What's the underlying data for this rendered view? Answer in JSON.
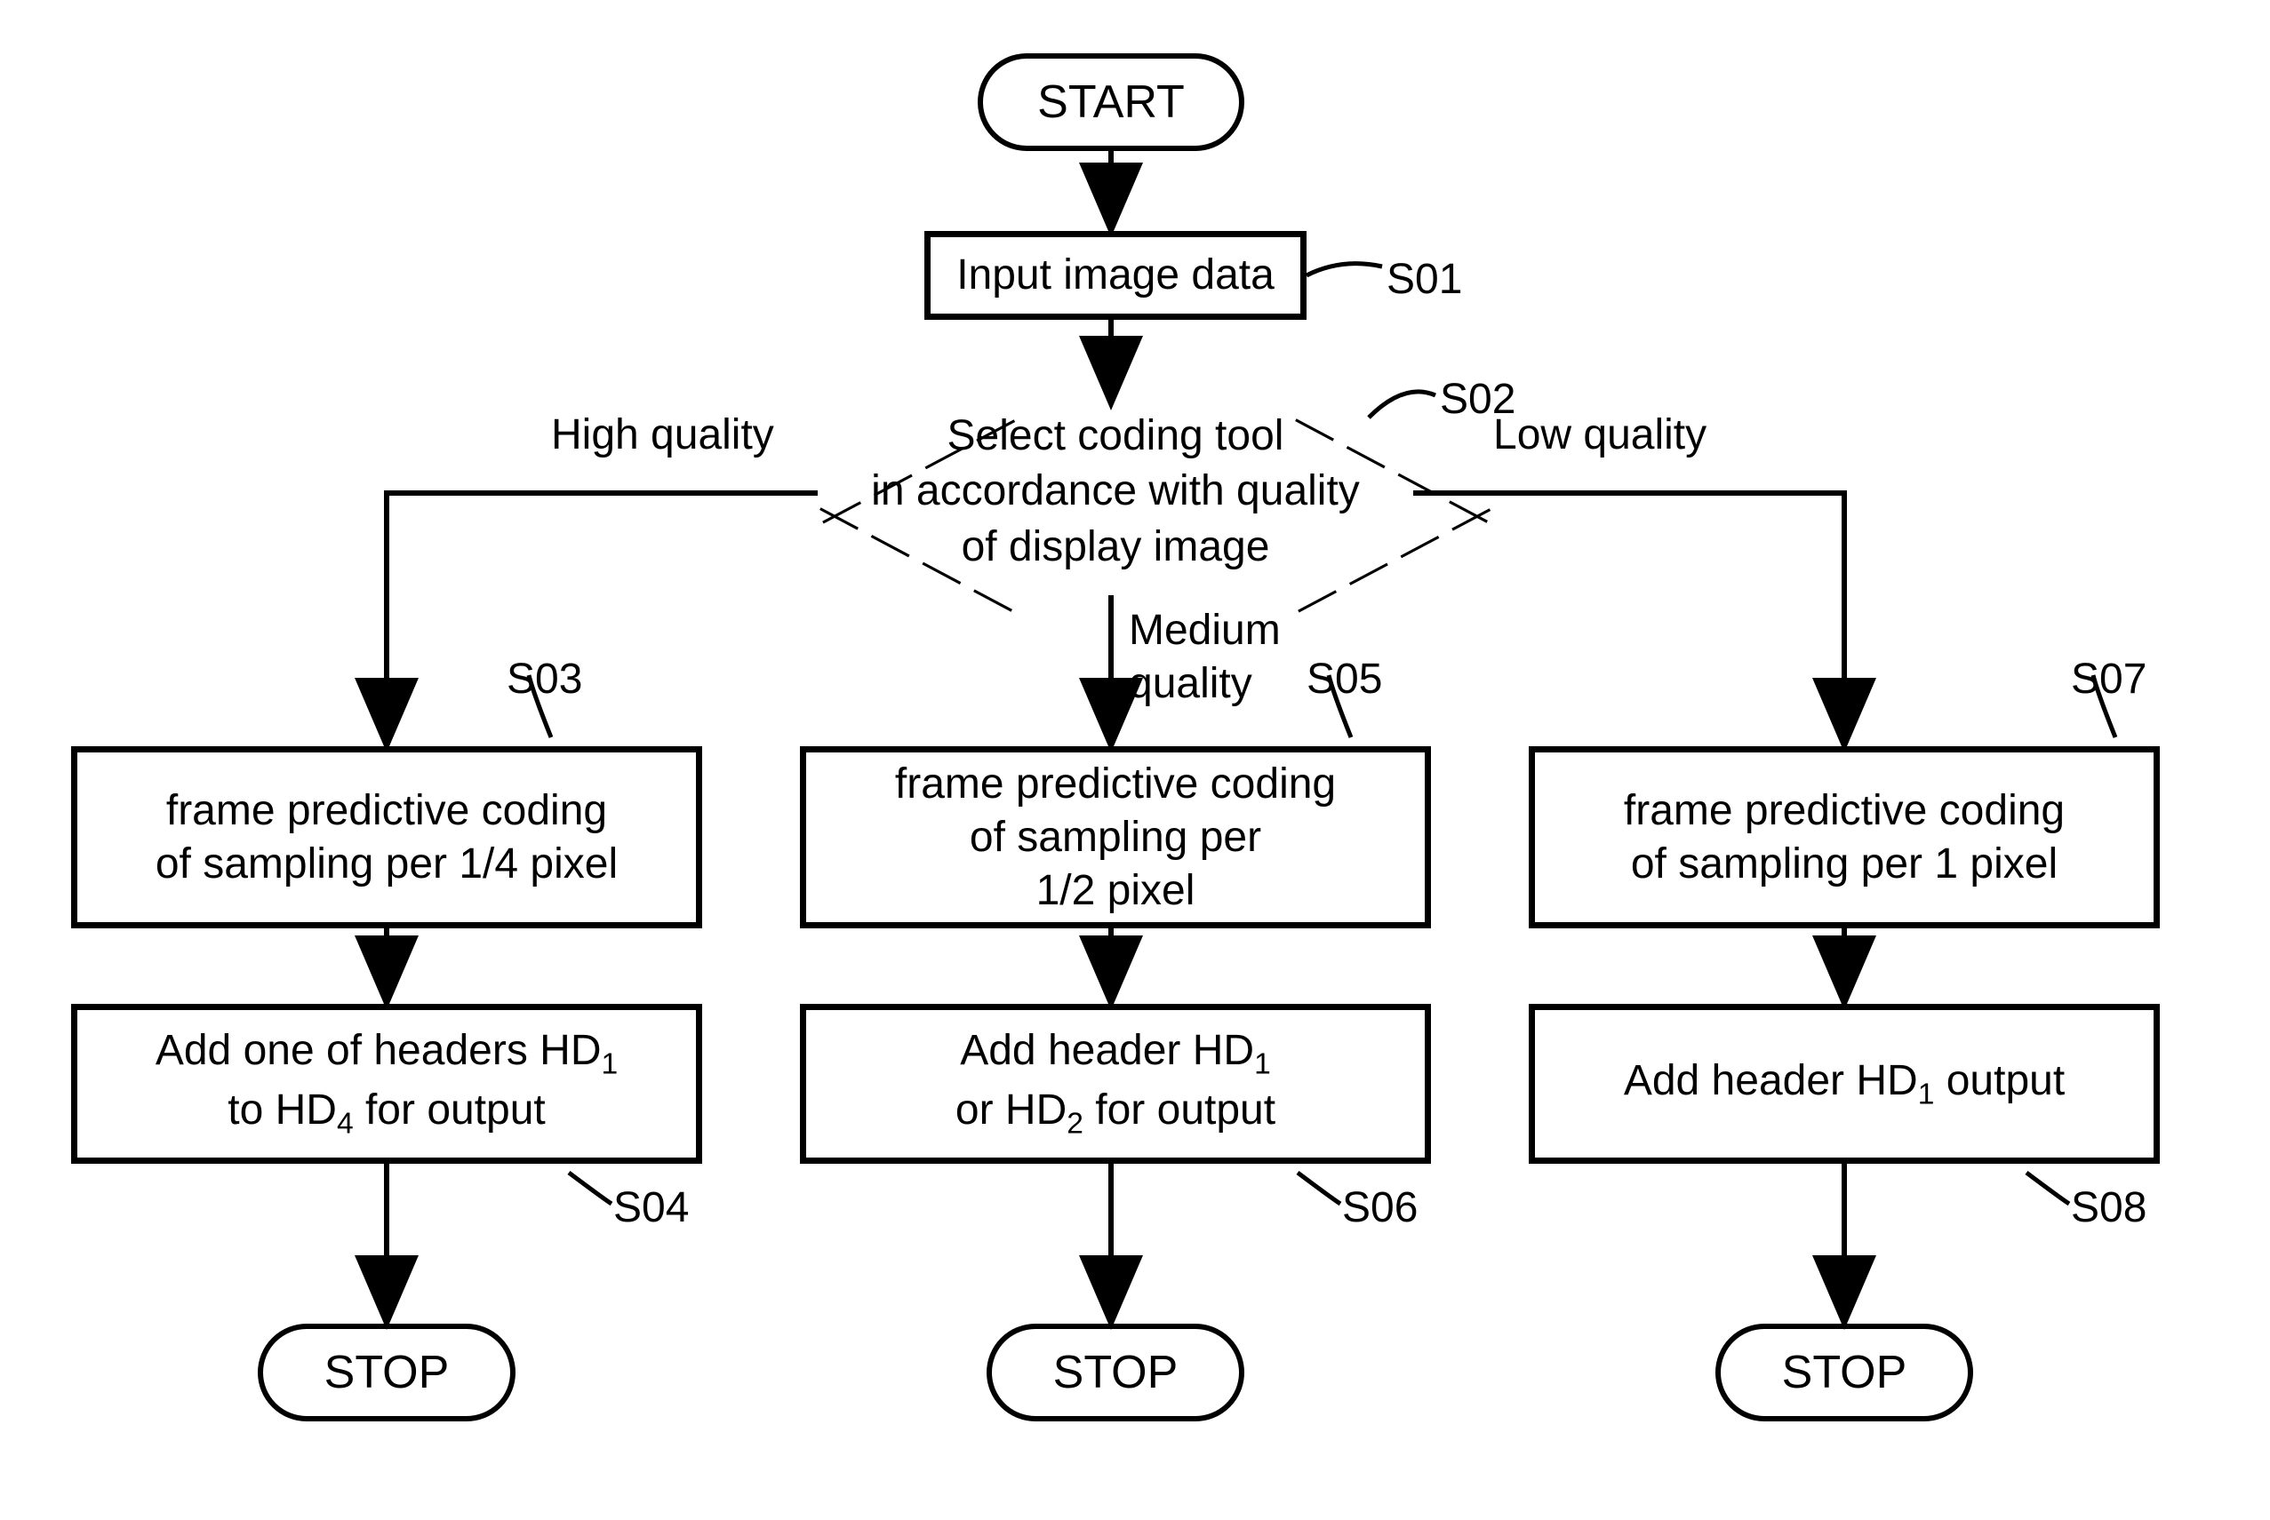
{
  "terminators": {
    "start": "START",
    "stop1": "STOP",
    "stop2": "STOP",
    "stop3": "STOP"
  },
  "steps": {
    "s01": {
      "label": "S01",
      "text": "Input image data"
    },
    "s02": {
      "label": "S02",
      "text_line1": "Select coding tool",
      "text_line2": "in accordance with quality",
      "text_line3": "of display image"
    },
    "s03": {
      "label": "S03",
      "text": "frame predictive coding\nof sampling per 1/4 pixel"
    },
    "s04": {
      "label": "S04",
      "text_pre": "Add one of headers HD",
      "text_sub1": "1",
      "text_mid": "\nto HD",
      "text_sub2": "4",
      "text_post": " for output"
    },
    "s05": {
      "label": "S05",
      "text": "frame predictive coding\nof sampling per\n1/2 pixel"
    },
    "s06": {
      "label": "S06",
      "text_pre": "Add header HD",
      "text_sub1": "1",
      "text_mid": "\nor HD",
      "text_sub2": "2",
      "text_post": " for output"
    },
    "s07": {
      "label": "S07",
      "text": "frame predictive coding\nof sampling per 1 pixel"
    },
    "s08": {
      "label": "S08",
      "text_pre": "Add header HD",
      "text_sub1": "1",
      "text_post": " output"
    }
  },
  "branches": {
    "high": "High quality",
    "medium": "Medium\nquality",
    "low": "Low quality"
  }
}
